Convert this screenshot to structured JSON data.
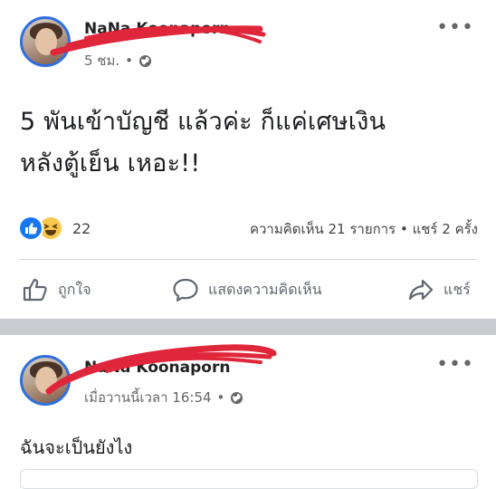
{
  "post1": {
    "author_name": "NaNa Koonaporn",
    "timestamp": "5 ชม.",
    "privacy_icon": "globe-icon",
    "more_icon": "more-dots-icon",
    "text_line1": "5 พันเข้าบัญชี แล้วค่ะ ก็แค่เศษเงิน",
    "text_line2": "หลังตู้เย็น เหอะ!!",
    "reaction_icons": [
      "like-reaction-icon",
      "haha-reaction-icon"
    ],
    "reaction_count": "22",
    "stats": "ความคิดเห็น 21 รายการ • แชร์ 2 ครั้ง",
    "actions": {
      "like": "ถูกใจ",
      "comment": "แสดงความคิดเห็น",
      "share": "แชร์"
    },
    "redaction_color": "#e0263a"
  },
  "post2": {
    "author_name": "NaNa Koonaporn",
    "timestamp": "เมื่อวานนี้เวลา 16:54",
    "privacy_icon": "globe-icon",
    "more_icon": "more-dots-icon",
    "text": "ฉันจะเป็นยังไง"
  },
  "colors": {
    "avatar_ring": "#2f6fdf",
    "separator": "#c9ccd1",
    "meta_text": "#65676b"
  }
}
